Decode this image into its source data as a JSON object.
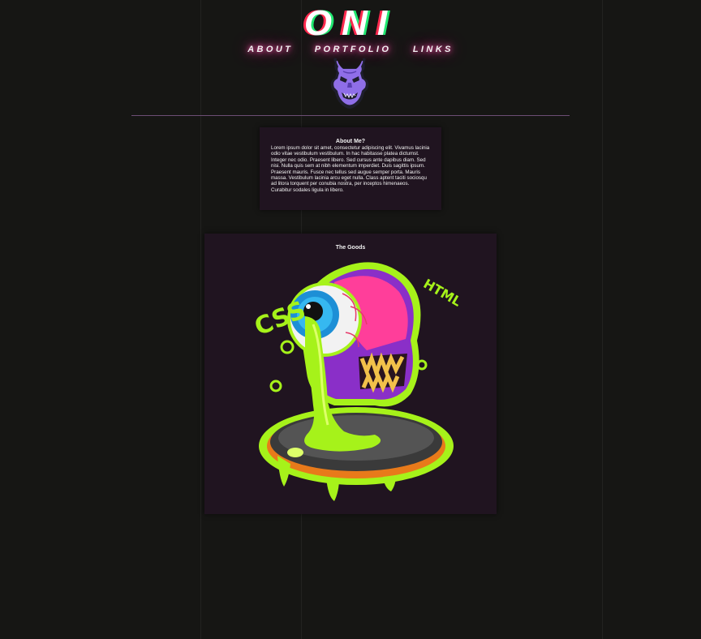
{
  "site": {
    "logo": "ONI"
  },
  "nav": {
    "items": [
      "ABOUT",
      "PORTFOLIO",
      "LINKS"
    ]
  },
  "about": {
    "title": "About Me?",
    "body": "Lorem ipsum dolor sit amet, consectetur adipiscing elit. Vivamus lacinia odio vitae vestibulum vestibulum. In hac habitasse platea dictumst. Integer nec odio. Praesent libero. Sed cursus ante dapibus diam. Sed nisi. Nulla quis sem at nibh elementum imperdiet. Duis sagittis ipsum. Praesent mauris. Fusce nec tellus sed augue semper porta. Mauris massa. Vestibulum lacinia arcu eget nulla. Class aptent taciti sociosqu ad litora torquent per conubia nostra, per inceptos himenaeos. Curabitur sodales ligula in libero."
  },
  "goods": {
    "title": "The Goods",
    "art_labels": {
      "left": "CSS",
      "right": "HTML"
    }
  },
  "colors": {
    "background": "#161614",
    "panel": "#201420",
    "accent_pink": "#ff3e9a",
    "logo_red": "#ff2a4e",
    "logo_green": "#20e870",
    "slime": "#a6f21a",
    "eye_blue": "#1d8fd6",
    "mask_purple": "#8f6ee8",
    "rule": "#6c4d74"
  },
  "icons": {
    "mask": "oni-mask-icon",
    "artwork": "eyeball-monster-illustration"
  }
}
